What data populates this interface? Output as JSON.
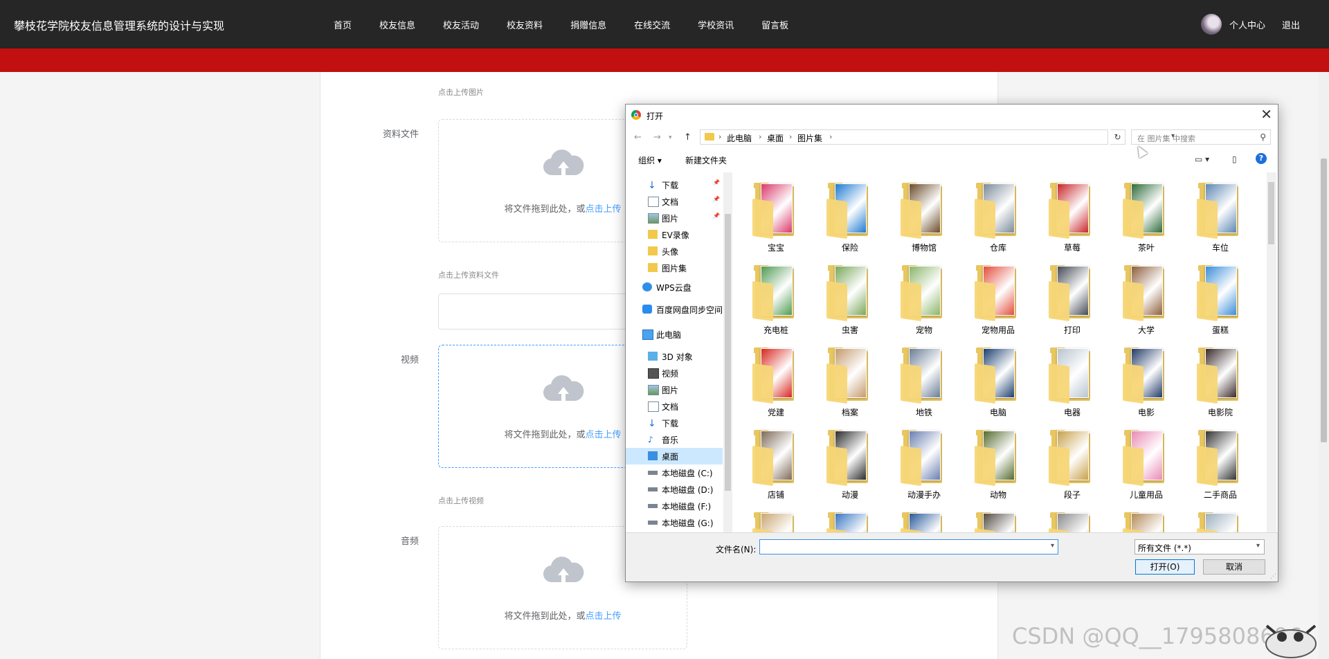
{
  "header": {
    "site_title": "攀枝花学院校友信息管理系统的设计与实现",
    "nav": [
      "首页",
      "校友信息",
      "校友活动",
      "校友资料",
      "捐赠信息",
      "在线交流",
      "学校资讯",
      "留言板"
    ],
    "user_center": "个人中心",
    "logout": "退出"
  },
  "form": {
    "image_hint": "点击上传图片",
    "file_label": "资料文件",
    "file_hint": "点击上传资料文件",
    "video_label": "视频",
    "video_hint": "点击上传视频",
    "audio_label": "音频",
    "drag_text": "将文件拖到此处，或",
    "upload_link": "点击上传"
  },
  "dialog": {
    "title": "打开",
    "breadcrumb": [
      "此电脑",
      "桌面",
      "图片集"
    ],
    "search_placeholder": "在 图片集 中搜索",
    "organize": "组织 ▾",
    "new_folder": "新建文件夹",
    "sidebar": [
      {
        "label": "下载",
        "icon": "download-icon",
        "pinned": true
      },
      {
        "label": "文档",
        "icon": "document-icon",
        "pinned": true
      },
      {
        "label": "图片",
        "icon": "pictures-icon",
        "pinned": true
      },
      {
        "label": "EV录像",
        "icon": "folder-icon",
        "pinned": false
      },
      {
        "label": "头像",
        "icon": "folder-icon",
        "pinned": false
      },
      {
        "label": "图片集",
        "icon": "folder-icon",
        "pinned": false
      },
      {
        "label": "WPS云盘",
        "icon": "cloud-icon",
        "pinned": false
      },
      {
        "label": "百度网盘同步空间",
        "icon": "baidu-icon",
        "pinned": false
      },
      {
        "label": "此电脑",
        "icon": "computer-icon",
        "pinned": false
      },
      {
        "label": "3D 对象",
        "icon": "3d-objects-icon",
        "pinned": false
      },
      {
        "label": "视频",
        "icon": "video-icon",
        "pinned": false
      },
      {
        "label": "图片",
        "icon": "pictures-icon",
        "pinned": false
      },
      {
        "label": "文档",
        "icon": "document-icon",
        "pinned": false
      },
      {
        "label": "下载",
        "icon": "download-icon",
        "pinned": false
      },
      {
        "label": "音乐",
        "icon": "music-icon",
        "pinned": false
      },
      {
        "label": "桌面",
        "icon": "desktop-icon",
        "pinned": false,
        "selected": true
      },
      {
        "label": "本地磁盘 (C:)",
        "icon": "drive-icon",
        "pinned": false
      },
      {
        "label": "本地磁盘 (D:)",
        "icon": "drive-icon",
        "pinned": false
      },
      {
        "label": "本地磁盘 (F:)",
        "icon": "drive-icon",
        "pinned": false
      },
      {
        "label": "本地磁盘 (G:)",
        "icon": "drive-icon",
        "pinned": false
      }
    ],
    "folders": [
      "宝宝",
      "保险",
      "博物馆",
      "仓库",
      "草莓",
      "茶叶",
      "车位",
      "充电桩",
      "虫害",
      "宠物",
      "宠物用品",
      "打印",
      "大学",
      "蛋糕",
      "党建",
      "档案",
      "地铁",
      "电脑",
      "电器",
      "电影",
      "电影院",
      "店铺",
      "动漫",
      "动漫手办",
      "动物",
      "段子",
      "儿童用品",
      "二手商品",
      "",
      "",
      "",
      "",
      "",
      "",
      ""
    ],
    "folder_colors": [
      "#d9386b",
      "#1e7bd0",
      "#6b4b2a",
      "#7b8a99",
      "#c8262a",
      "#2e6b3a",
      "#5d87b3",
      "#4f9a52",
      "#7aa65a",
      "#8bb56a",
      "#e24d3c",
      "#444a55",
      "#8c5e3b",
      "#3a8dd8",
      "#d7261e",
      "#c49a6c",
      "#6a7d96",
      "#1c3f6e",
      "#b9c4cf",
      "#223a66",
      "#3a2a2a",
      "#7e6a58",
      "#2b2b2b",
      "#6a7fb0",
      "#556b2f",
      "#c7a14a",
      "#e98bb5",
      "#333333",
      "#c9a672",
      "#3a77c2",
      "#295a9c",
      "#514a42",
      "#8a8a8a",
      "#b38b5a",
      "#9db0c0"
    ],
    "filename_label": "文件名(N):",
    "filename_value": "",
    "filetype": "所有文件 (*.*)",
    "open_button": "打开(O)",
    "cancel_button": "取消"
  },
  "watermark": "CSDN @QQ__1795808696"
}
